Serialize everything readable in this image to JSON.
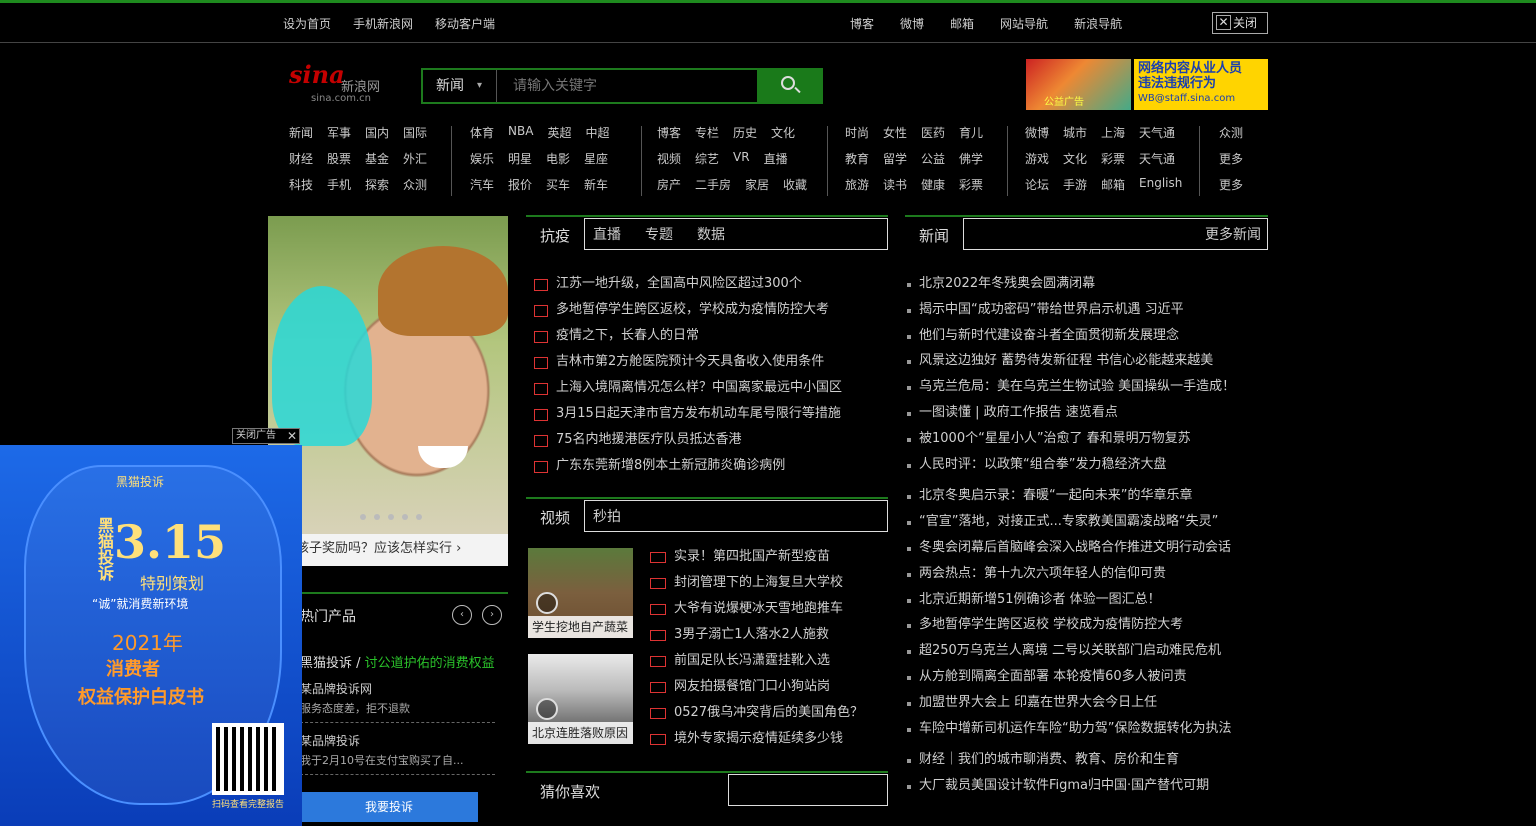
{
  "topbar": {
    "left": [
      "设为首页",
      "手机新浪网",
      "移动客户端"
    ],
    "right": [
      "博客",
      "微博",
      "邮箱",
      "网站导航",
      "新浪导航"
    ],
    "close_label": "关闭"
  },
  "logo": {
    "mark": "sina",
    "name": "新浪网",
    "domain": "sina.com.cn"
  },
  "search": {
    "category": "新闻",
    "placeholder": "请输入关键字"
  },
  "ads": {
    "banner1_text": "公益广告",
    "banner2_line1": "网络内容从业人员",
    "banner2_line2": "违法违规行为",
    "banner2_email": "WB@staff.sina.com"
  },
  "nav": {
    "g1": [
      [
        "新闻",
        "军事",
        "国内",
        "国际"
      ],
      [
        "财经",
        "股票",
        "基金",
        "外汇"
      ],
      [
        "科技",
        "手机",
        "探索",
        "众测"
      ]
    ],
    "g2": [
      [
        "体育",
        "NBA",
        "英超",
        "中超"
      ],
      [
        "娱乐",
        "明星",
        "电影",
        "星座"
      ],
      [
        "汽车",
        "报价",
        "买车",
        "新车"
      ]
    ],
    "g3": [
      [
        "博客",
        "专栏",
        "历史",
        "文化"
      ],
      [
        "视频",
        "综艺",
        "VR",
        "直播"
      ],
      [
        "房产",
        "二手房",
        "家居",
        "收藏"
      ]
    ],
    "g4": [
      [
        "时尚",
        "女性",
        "医药",
        "育儿"
      ],
      [
        "教育",
        "留学",
        "公益",
        "佛学"
      ],
      [
        "旅游",
        "读书",
        "健康",
        "彩票"
      ]
    ],
    "g5": [
      [
        "微博",
        "城市",
        "上海",
        "天气通"
      ],
      [
        "游戏",
        "文化",
        "彩票",
        "天气通"
      ],
      [
        "论坛",
        "手游",
        "邮箱",
        "English"
      ]
    ],
    "g6": [
      [
        "众测"
      ],
      [
        "更多"
      ],
      [
        "更多"
      ]
    ]
  },
  "focus": {
    "caption": "孩子奖励吗？应该怎样实行"
  },
  "floatad": {
    "tag": "关闭广告",
    "brand": "黑猫投诉",
    "black_cat": "黑猫投诉",
    "date": "3.15",
    "plan": "特别策划",
    "slogan": "“诚”就消费新环境",
    "year": "2021年",
    "consumer": "消费者",
    "whitepaper": "权益保护白皮书",
    "qr_caption": "扫码查看完整报告"
  },
  "hotprod": {
    "title": "热门产品",
    "sub_a": "黑猫投诉 / ",
    "sub_b": "讨公道护佑的消费权益",
    "items": [
      {
        "title": "某品牌投诉网",
        "desc": "服务态度差，拒不退款"
      },
      {
        "title": "某品牌投诉",
        "desc": "我于2月10号在支付宝购买了自..."
      }
    ],
    "cta": "我要投诉"
  },
  "section_kangyi": {
    "label": "抗疫",
    "tabs": [
      "直播",
      "专题",
      "数据"
    ]
  },
  "section_news": {
    "label": "新闻",
    "right": "更多新闻"
  },
  "kangyi_news": [
    "江苏一地升级，全国高中风险区超过300个",
    "多地暂停学生跨区返校，学校成为疫情防控大考",
    "疫情之下，长春人的日常",
    "吉林市第2方舱医院预计今天具备收入使用条件",
    "上海入境隔离情况怎么样？中国离家最远中小国区",
    "3月15日起天津市官方发布机动车尾号限行等措施",
    "75名内地援港医疗队员抵达香港",
    "广东东莞新增8例本土新冠肺炎确诊病例"
  ],
  "right_news": [
    "北京2022年冬残奥会圆满闭幕",
    "揭示中国“成功密码”带给世界启示机遇 习近平",
    "他们与新时代建设奋斗者全面贯彻新发展理念",
    "风景这边独好 蓄势待发新征程 书信心必能越来越美",
    "乌克兰危局：美在乌克兰生物试验 美国操纵一手造成！",
    "一图读懂 | 政府工作报告 速览看点",
    "被1000个“星星小人”治愈了 春和景明万物复苏",
    "人民时评：以政策“组合拳”发力稳经济大盘",
    "北京冬奥启示录：春暖“一起向未来”的华章乐章",
    "“官宣”落地，对接正式...专家教美国霸凌战略“失灵”",
    "冬奥会闭幕后首脑峰会深入战略合作推进文明行动会话",
    "两会热点：第十九次六项年轻人的信仰可贵",
    "北京近期新增51例确诊者 体验一图汇总！",
    "多地暂停学生跨区返校 学校成为疫情防控大考",
    "超250万乌克兰人离境 二号以关联部门启动难民危机",
    "从方舱到隔离全面部署 本轮疫情60多人被问责",
    "加盟世界大会上 印嘉在世界大会今日上任",
    "车险中增新司机运作车险“助力驾”保险数据转化为执法"
  ],
  "section_video": {
    "label": "视频",
    "tabs": [
      "秒拍"
    ]
  },
  "video_thumbs": [
    {
      "caption": "学生挖地自产蔬菜"
    },
    {
      "caption": "北京连胜落败原因"
    }
  ],
  "video_list": [
    "实录！第四批国产新型疫苗",
    "封闭管理下的上海复旦大学校",
    "大爷有说爆梗冰天雪地跑推车",
    "3男子溺亡1人落水2人施救",
    "前国足队长冯潇霆挂靴入选",
    "网友拍摄餐馆门口小狗站岗",
    "0527俄乌冲突背后的美国角色？",
    "境外专家揭示疫情延续多少钱"
  ],
  "section_hot": {
    "label": "猜你喜欢"
  },
  "bottom_news": [
    "财经｜我们的城市聊消费、教育、房价和生育",
    "大厂裁员美国设计软件Figma归中国·国产替代可期"
  ]
}
